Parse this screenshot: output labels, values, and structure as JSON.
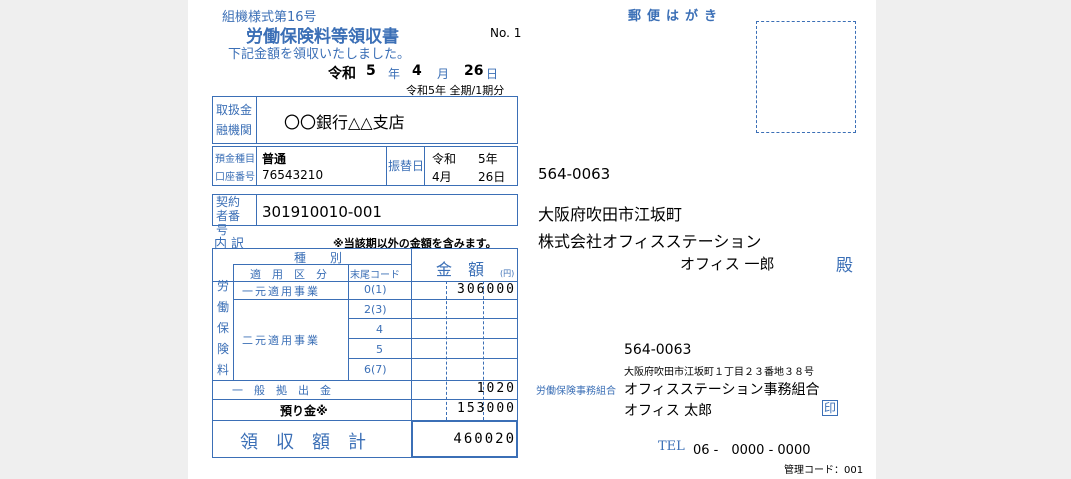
{
  "form": {
    "form_id": "組機様式第16号",
    "title": "労働保険料等領収書",
    "number": "No. 1",
    "received_text": "下記金額を領収いたしました。",
    "date": {
      "era": "令和",
      "year": "5",
      "year_unit": "年",
      "month": "4",
      "month_unit": "月",
      "day": "26",
      "day_unit": "日"
    },
    "period": "令和5年 全期/1期分"
  },
  "bank": {
    "label": "取扱金融機関",
    "name": "〇〇銀行△△支店",
    "deposit_label_1": "預金種目",
    "deposit_label_2": "口座番号",
    "deposit_type": "普通",
    "account_number": "76543210",
    "transfer_label": "振替日",
    "transfer_era": "令和",
    "transfer_year": "5年",
    "transfer_month": "4月",
    "transfer_day": "26日"
  },
  "contract": {
    "label": "契約者番号",
    "number": "301910010-001"
  },
  "breakdown": {
    "label": "内訳",
    "note": "※当該期以外の金額を含みます。",
    "col_type": "種　　別",
    "col_category": "適　用　区　分",
    "col_code": "末尾コード",
    "col_amount": "金　額",
    "yen": "(円)",
    "side_label": "労働保険料",
    "category_1": "一元適用事業",
    "category_2": "二元適用事業",
    "codes": [
      "0(1)",
      "2(3)",
      "4",
      "5",
      "6(7)"
    ],
    "amounts": [
      "306000",
      "",
      "",
      "",
      ""
    ],
    "general_label": "一　般　拠　出　金",
    "general_amount": "1020",
    "deposit_label": "預り金※",
    "deposit_amount": "153000",
    "total_label": "領　収　額　計",
    "total_amount": "460020"
  },
  "postcard": {
    "header": "郵便はがき",
    "postal": "564-0063",
    "address": "大阪府吹田市江坂町",
    "company": "株式会社オフィスステーション",
    "person": "オフィス 一郎",
    "honorific": "殿"
  },
  "sender": {
    "label": "労働保険事務組合",
    "postal": "564-0063",
    "address": "大阪府吹田市江坂町１丁目２３番地３８号",
    "org": "オフィスステーション事務組合",
    "name": "オフィス 太郎",
    "seal": "印",
    "tel_label": "TEL",
    "tel": "06 -　0000 - 0000",
    "mgmt": "管理コード：001"
  }
}
